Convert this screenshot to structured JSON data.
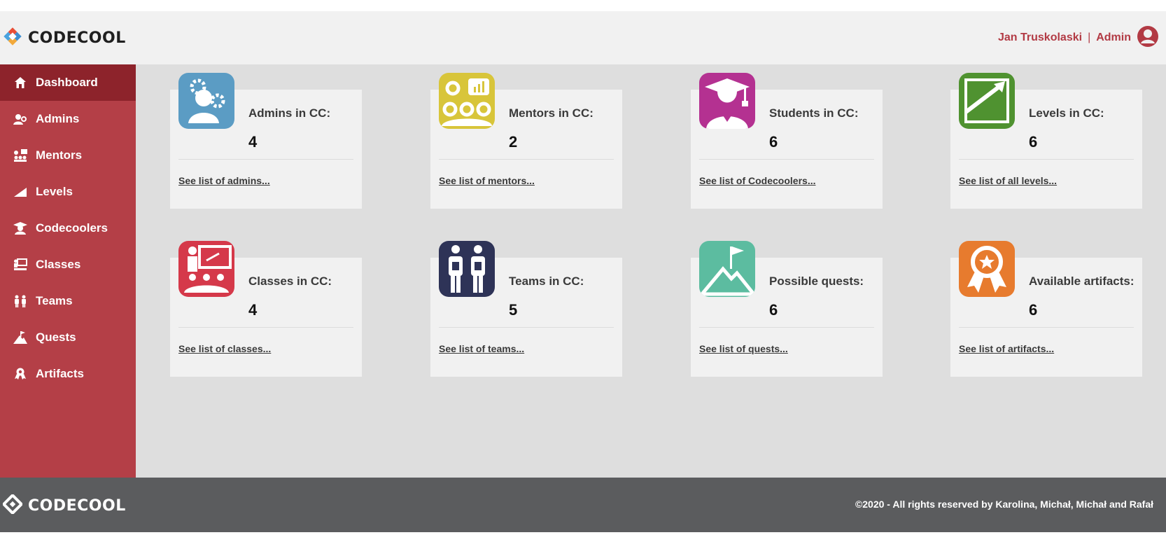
{
  "header": {
    "brand": "CODECOOL",
    "user_name": "Jan Truskolaski",
    "separator": "|",
    "user_role": "Admin"
  },
  "sidebar": {
    "items": [
      {
        "label": "Dashboard",
        "icon": "home-icon",
        "active": true
      },
      {
        "label": "Admins",
        "icon": "admin-icon",
        "active": false
      },
      {
        "label": "Mentors",
        "icon": "mentor-icon",
        "active": false
      },
      {
        "label": "Levels",
        "icon": "levels-icon",
        "active": false
      },
      {
        "label": "Codecoolers",
        "icon": "student-icon",
        "active": false
      },
      {
        "label": "Classes",
        "icon": "classes-icon",
        "active": false
      },
      {
        "label": "Teams",
        "icon": "teams-icon",
        "active": false
      },
      {
        "label": "Quests",
        "icon": "quests-icon",
        "active": false
      },
      {
        "label": "Artifacts",
        "icon": "artifacts-icon",
        "active": false
      }
    ]
  },
  "cards": [
    {
      "title": "Admins in CC:",
      "count": "4",
      "link": "See list of admins...",
      "icon": "admin-icon",
      "color": "#5b9cc4"
    },
    {
      "title": "Mentors in CC:",
      "count": "2",
      "link": "See list of mentors...",
      "icon": "mentor-icon",
      "color": "#d8c53a"
    },
    {
      "title": "Students in CC:",
      "count": "6",
      "link": "See list of Codecoolers...",
      "icon": "student-icon",
      "color": "#b43191"
    },
    {
      "title": "Levels in CC:",
      "count": "6",
      "link": "See list of all levels...",
      "icon": "levels-icon",
      "color": "#4f9230"
    },
    {
      "title": "Classes in CC:",
      "count": "4",
      "link": "See list of classes...",
      "icon": "classes-icon",
      "color": "#d5394a"
    },
    {
      "title": "Teams in CC:",
      "count": "5",
      "link": "See list of teams...",
      "icon": "teams-icon",
      "color": "#2e3357"
    },
    {
      "title": "Possible quests:",
      "count": "6",
      "link": "See list of quests...",
      "icon": "quests-icon",
      "color": "#5cbca0"
    },
    {
      "title": "Available artifacts:",
      "count": "6",
      "link": "See list of artifacts...",
      "icon": "artifacts-icon",
      "color": "#e77b2e"
    }
  ],
  "footer": {
    "brand": "CODECOOL",
    "copyright": "©2020 - All rights reserved by Karolina, Michał, Michał and Rafał"
  },
  "colors": {
    "accent": "#b43f47",
    "accent_dark": "#8d232b",
    "footer": "#5b5c5e",
    "main_bg": "#dedede",
    "card_bg": "#f1f1f1"
  }
}
